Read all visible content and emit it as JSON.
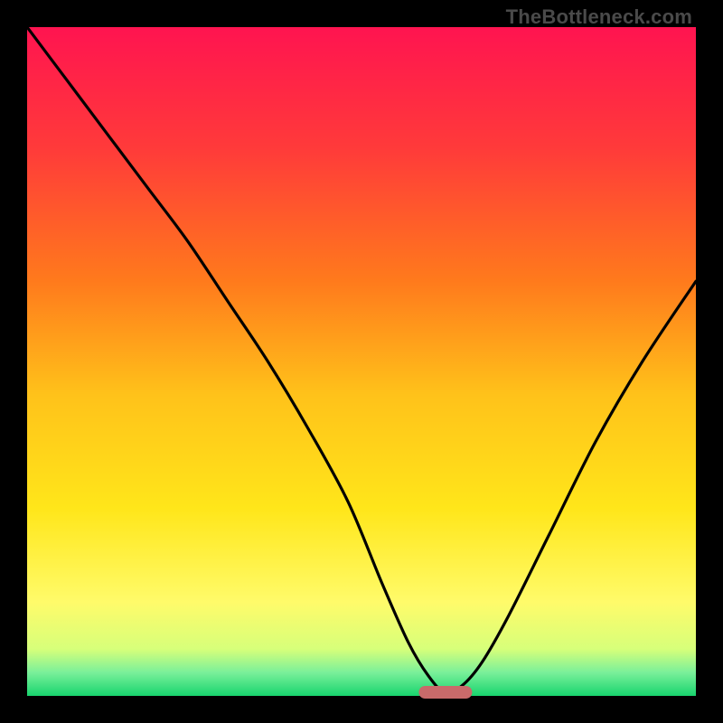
{
  "watermark": "TheBottleneck.com",
  "chart_data": {
    "type": "line",
    "title": "",
    "xlabel": "",
    "ylabel": "",
    "xlim": [
      0,
      100
    ],
    "ylim": [
      0,
      100
    ],
    "grid": false,
    "legend": false,
    "gradient_stops": [
      {
        "pos": 0.0,
        "color": "#ff1450"
      },
      {
        "pos": 0.18,
        "color": "#ff3a3a"
      },
      {
        "pos": 0.38,
        "color": "#ff7a1c"
      },
      {
        "pos": 0.55,
        "color": "#ffc21a"
      },
      {
        "pos": 0.72,
        "color": "#ffe61a"
      },
      {
        "pos": 0.86,
        "color": "#fffb6a"
      },
      {
        "pos": 0.93,
        "color": "#d7ff7a"
      },
      {
        "pos": 0.965,
        "color": "#7af09a"
      },
      {
        "pos": 1.0,
        "color": "#18d46e"
      }
    ],
    "series": [
      {
        "name": "bottleneck-curve",
        "x": [
          0,
          6,
          12,
          18,
          24,
          30,
          36,
          42,
          48,
          53,
          57,
          60,
          62.5,
          65,
          68,
          72,
          78,
          85,
          92,
          100
        ],
        "y": [
          100,
          92,
          84,
          76,
          68,
          59,
          50,
          40,
          29,
          17,
          8,
          3,
          0.5,
          1.5,
          5,
          12,
          24,
          38,
          50,
          62
        ]
      }
    ],
    "marker": {
      "x_center_pct": 62.5,
      "y_pct": 0.5,
      "width_pct": 8
    }
  }
}
